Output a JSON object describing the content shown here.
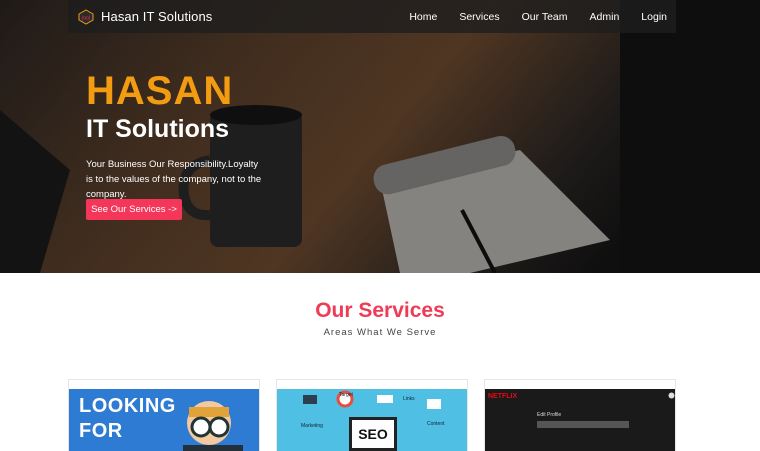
{
  "nav": {
    "brand": "Hasan IT Solutions",
    "links": [
      "Home",
      "Services",
      "Our Team",
      "Admin",
      "Login"
    ]
  },
  "hero": {
    "title": "HASAN",
    "subtitle": "IT Solutions",
    "description": "Your Business Our Responsibility.Loyalty is to the values of the company, not to the company.",
    "cta": "See Our Services ->"
  },
  "services": {
    "title": "Our Services",
    "subtitle": "Areas What We Serve",
    "cards": [
      {
        "image_text_1": "LOOKING",
        "image_text_2": "FOR"
      },
      {
        "image_text": "SEO",
        "labels": [
          "Target",
          "Links",
          "Marketing",
          "Content"
        ]
      },
      {
        "logo": "NETFLIX",
        "heading": "Edit Profile"
      }
    ]
  },
  "colors": {
    "accent": "#f39c12",
    "button": "#f4365a",
    "section_title": "#ef3b55"
  }
}
